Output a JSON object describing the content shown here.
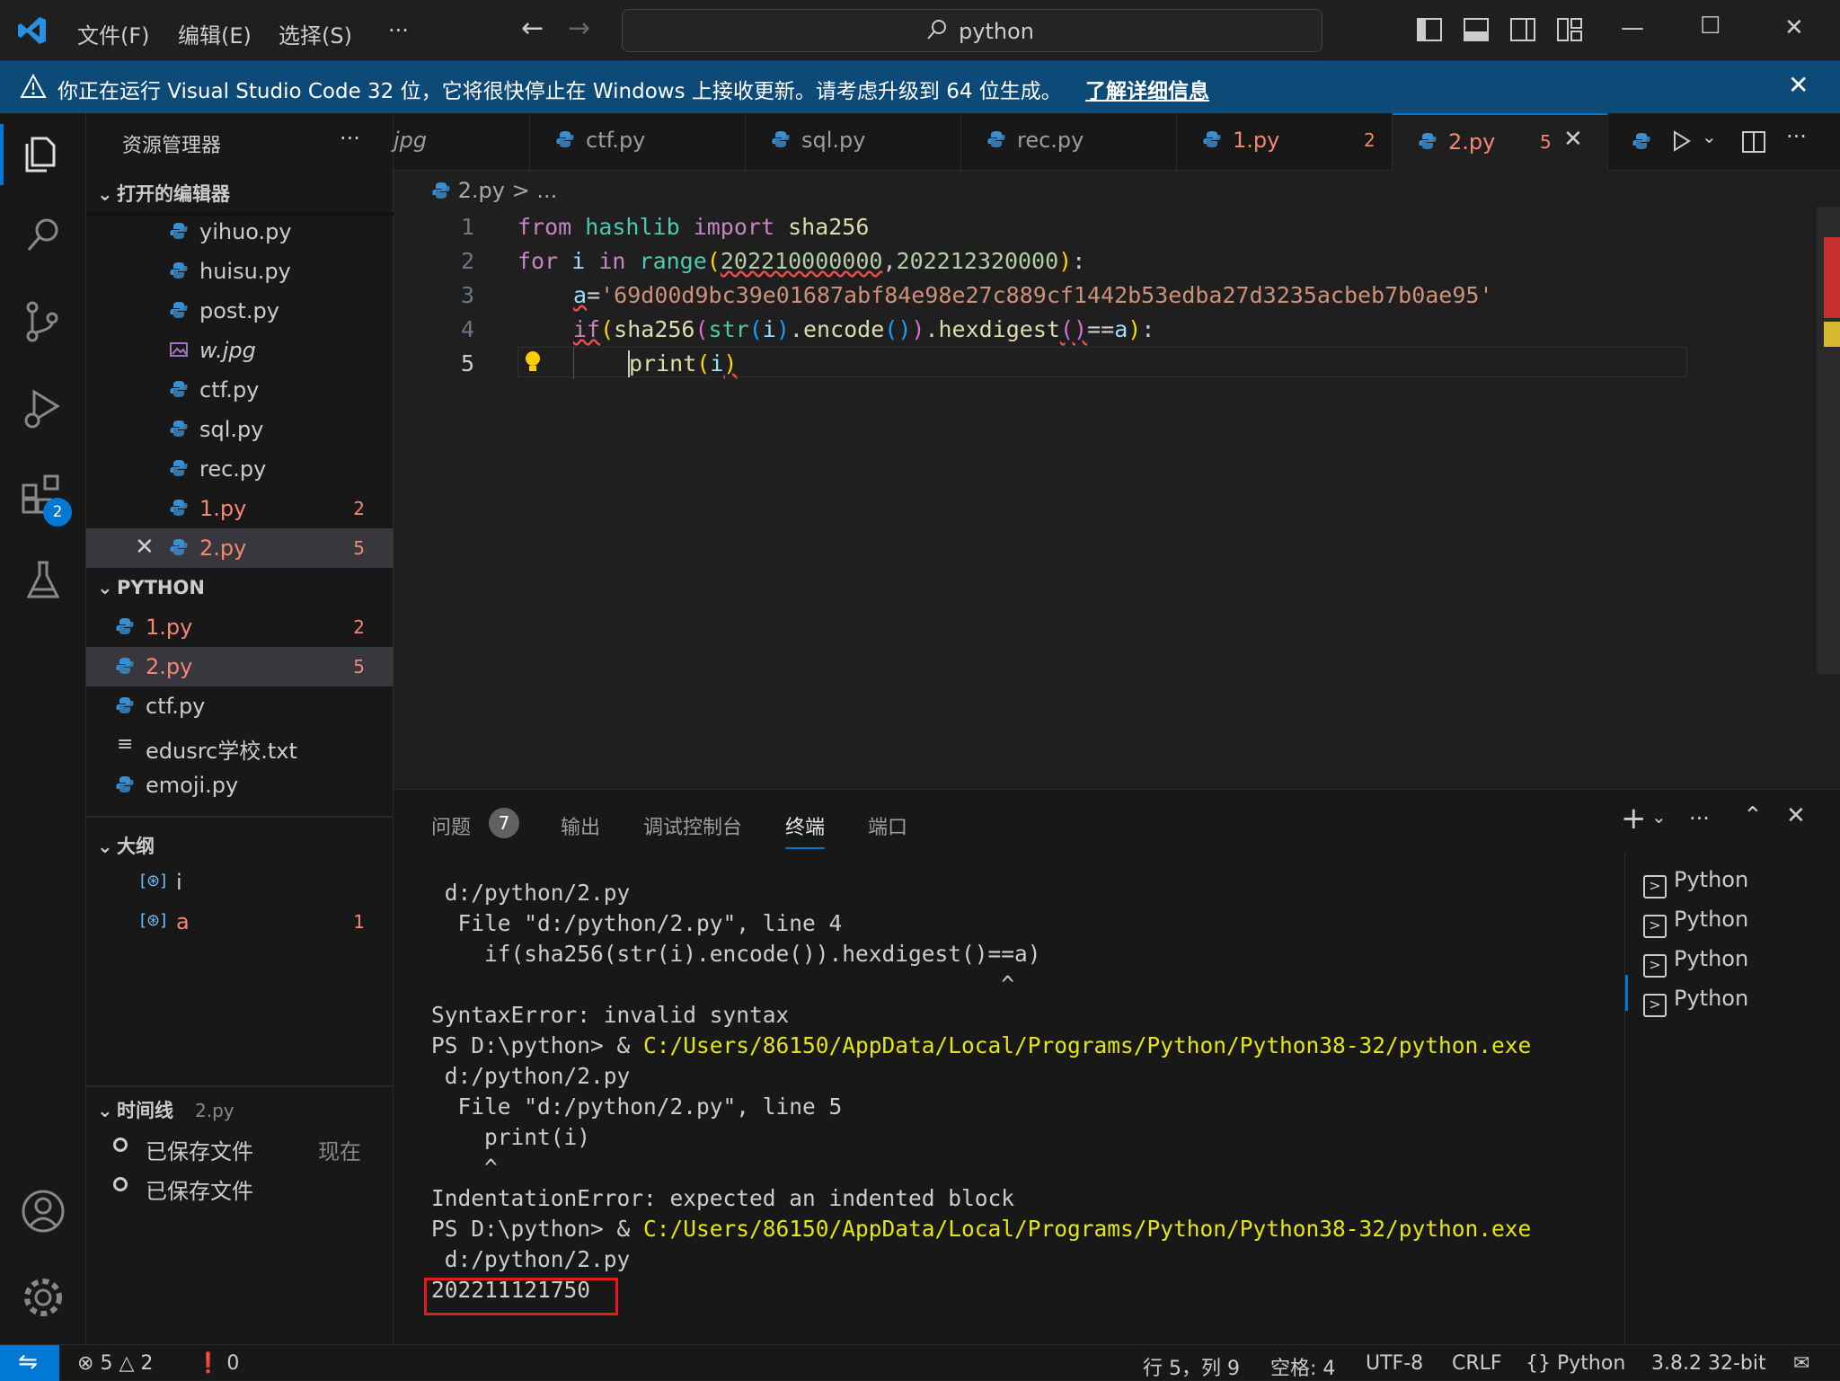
{
  "titlebar": {
    "menus": [
      "文件(F)",
      "编辑(E)",
      "选择(S)",
      "···"
    ],
    "search_text": "python"
  },
  "banner": {
    "message": "你正在运行 Visual Studio Code 32 位，它将很快停止在 Windows 上接收更新。请考虑升级到 64 位生成。",
    "link": "了解详细信息"
  },
  "activity_bar": {
    "extensions_badge": "2",
    "icons": [
      "explorer-icon",
      "search-icon",
      "source-control-icon",
      "run-debug-icon",
      "extensions-icon",
      "testing-icon",
      "account-icon",
      "settings-gear-icon"
    ]
  },
  "sidebar": {
    "title": "资源管理器",
    "more": "···",
    "open_editors": {
      "label": "打开的编辑器",
      "items": [
        {
          "name": "yihuo.py",
          "badge": ""
        },
        {
          "name": "huisu.py",
          "badge": ""
        },
        {
          "name": "post.py",
          "badge": ""
        },
        {
          "name": "w.jpg",
          "badge": ""
        },
        {
          "name": "ctf.py",
          "badge": ""
        },
        {
          "name": "sql.py",
          "badge": ""
        },
        {
          "name": "rec.py",
          "badge": ""
        },
        {
          "name": "1.py",
          "badge": "2"
        },
        {
          "name": "2.py",
          "badge": "5"
        }
      ]
    },
    "folder": {
      "label": "PYTHON",
      "items": [
        {
          "name": "1.py",
          "badge": "2"
        },
        {
          "name": "2.py",
          "badge": "5"
        },
        {
          "name": "ctf.py",
          "badge": ""
        },
        {
          "name": "edusrc学校.txt",
          "badge": ""
        },
        {
          "name": "emoji.py",
          "badge": ""
        }
      ]
    },
    "outline": {
      "label": "大纲",
      "items": [
        {
          "name": "i",
          "badge": ""
        },
        {
          "name": "a",
          "badge": "1"
        }
      ]
    },
    "timeline": {
      "label": "时间线",
      "file": "2.py",
      "items": [
        {
          "name": "已保存文件",
          "time": "现在"
        },
        {
          "name": "已保存文件",
          "time": ""
        }
      ]
    }
  },
  "tabs": [
    {
      "name": "jpg",
      "badge": ""
    },
    {
      "name": "ctf.py",
      "badge": ""
    },
    {
      "name": "sql.py",
      "badge": ""
    },
    {
      "name": "rec.py",
      "badge": ""
    },
    {
      "name": "1.py",
      "badge": "2"
    },
    {
      "name": "2.py",
      "badge": "5"
    }
  ],
  "breadcrumb": {
    "file": "2.py",
    "sep": ">",
    "rest": "..."
  },
  "editor": {
    "line_numbers": [
      "1",
      "2",
      "3",
      "4",
      "5"
    ],
    "code": {
      "l1": [
        "from",
        "hashlib",
        "import",
        "sha256"
      ],
      "l2": [
        "for",
        "i",
        "in",
        "range",
        "(",
        "202210000000",
        ",",
        "202212320000",
        ")",
        ":"
      ],
      "l3": [
        "a",
        "=",
        "'69d00d9bc39e01687abf84e98e27c889cf1442b53edba27d3235acbeb7b0ae95'"
      ],
      "l4": [
        "if",
        "(",
        "sha256",
        "(",
        "str",
        "(",
        "i",
        ")",
        ".",
        "encode",
        "()",
        ")",
        ".",
        "hexdigest",
        "()",
        "==",
        "a",
        ")",
        ":"
      ],
      "l5": [
        "print",
        "(",
        "i",
        ")"
      ]
    }
  },
  "panel": {
    "tabs": [
      "问题",
      "输出",
      "调试控制台",
      "终端",
      "端口"
    ],
    "problems_count": "7",
    "active_tab": "终端",
    "terminal_lines": [
      {
        "text": " d:/python/2.py",
        "hl": ""
      },
      {
        "text": "  File \"d:/python/2.py\", line 4",
        "hl": ""
      },
      {
        "text": "    if(sha256(str(i).encode()).hexdigest()==a)",
        "hl": ""
      },
      {
        "text": "                                           ^",
        "hl": ""
      },
      {
        "text": "SyntaxError: invalid syntax",
        "hl": ""
      },
      {
        "text": "PS D:\\python> & ",
        "hl": "C:/Users/86150/AppData/Local/Programs/Python/Python38-32/python.exe"
      },
      {
        "text": " d:/python/2.py",
        "hl": ""
      },
      {
        "text": "  File \"d:/python/2.py\", line 5",
        "hl": ""
      },
      {
        "text": "    print(i)",
        "hl": ""
      },
      {
        "text": "    ^",
        "hl": ""
      },
      {
        "text": "IndentationError: expected an indented block",
        "hl": ""
      },
      {
        "text": "PS D:\\python> & ",
        "hl": "C:/Users/86150/AppData/Local/Programs/Python/Python38-32/python.exe"
      },
      {
        "text": " d:/python/2.py",
        "hl": ""
      },
      {
        "text": "202211121750",
        "hl": ""
      }
    ],
    "terminal_instances": [
      "Python",
      "Python",
      "Python",
      "Python"
    ]
  },
  "statusbar": {
    "errors": "5",
    "warnings": "2",
    "ports": "0",
    "position": "行 5，列 9",
    "spaces": "空格: 4",
    "encoding": "UTF-8",
    "eol": "CRLF",
    "language": "Python",
    "interpreter": "3.8.2 32-bit"
  },
  "colors": {
    "accent": "#0078d4",
    "banner": "#0e4a78",
    "error": "#f48771",
    "highlight_box": "#e51b1b"
  }
}
